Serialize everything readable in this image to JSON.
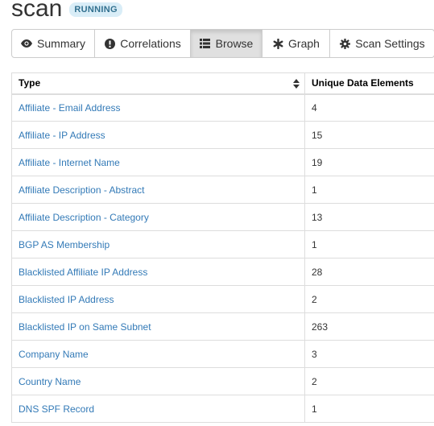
{
  "scan": {
    "title": "scan",
    "status": "RUNNING"
  },
  "tabs": [
    {
      "label": "Summary",
      "icon": "eye-icon",
      "active": false
    },
    {
      "label": "Correlations",
      "icon": "exclamation-circle-icon",
      "active": false
    },
    {
      "label": "Browse",
      "icon": "list-icon",
      "active": true
    },
    {
      "label": "Graph",
      "icon": "asterisk-icon",
      "active": false
    },
    {
      "label": "Scan Settings",
      "icon": "gear-icon",
      "active": false
    }
  ],
  "table": {
    "headers": {
      "type": "Type",
      "count": "Unique Data Elements"
    },
    "rows": [
      {
        "type": "Affiliate - Email Address",
        "count": "4"
      },
      {
        "type": "Affiliate - IP Address",
        "count": "15"
      },
      {
        "type": "Affiliate - Internet Name",
        "count": "19"
      },
      {
        "type": "Affiliate Description - Abstract",
        "count": "1"
      },
      {
        "type": "Affiliate Description - Category",
        "count": "13"
      },
      {
        "type": "BGP AS Membership",
        "count": "1"
      },
      {
        "type": "Blacklisted Affiliate IP Address",
        "count": "28"
      },
      {
        "type": "Blacklisted IP Address",
        "count": "2"
      },
      {
        "type": "Blacklisted IP on Same Subnet",
        "count": "263"
      },
      {
        "type": "Company Name",
        "count": "3"
      },
      {
        "type": "Country Name",
        "count": "2"
      },
      {
        "type": "DNS SPF Record",
        "count": "1"
      }
    ]
  },
  "colors": {
    "link": "#337ab7",
    "badge_bg": "#d9edf7",
    "badge_text": "#31708f",
    "active_tab_bg": "#e0e0e0",
    "border": "#dddddd"
  }
}
